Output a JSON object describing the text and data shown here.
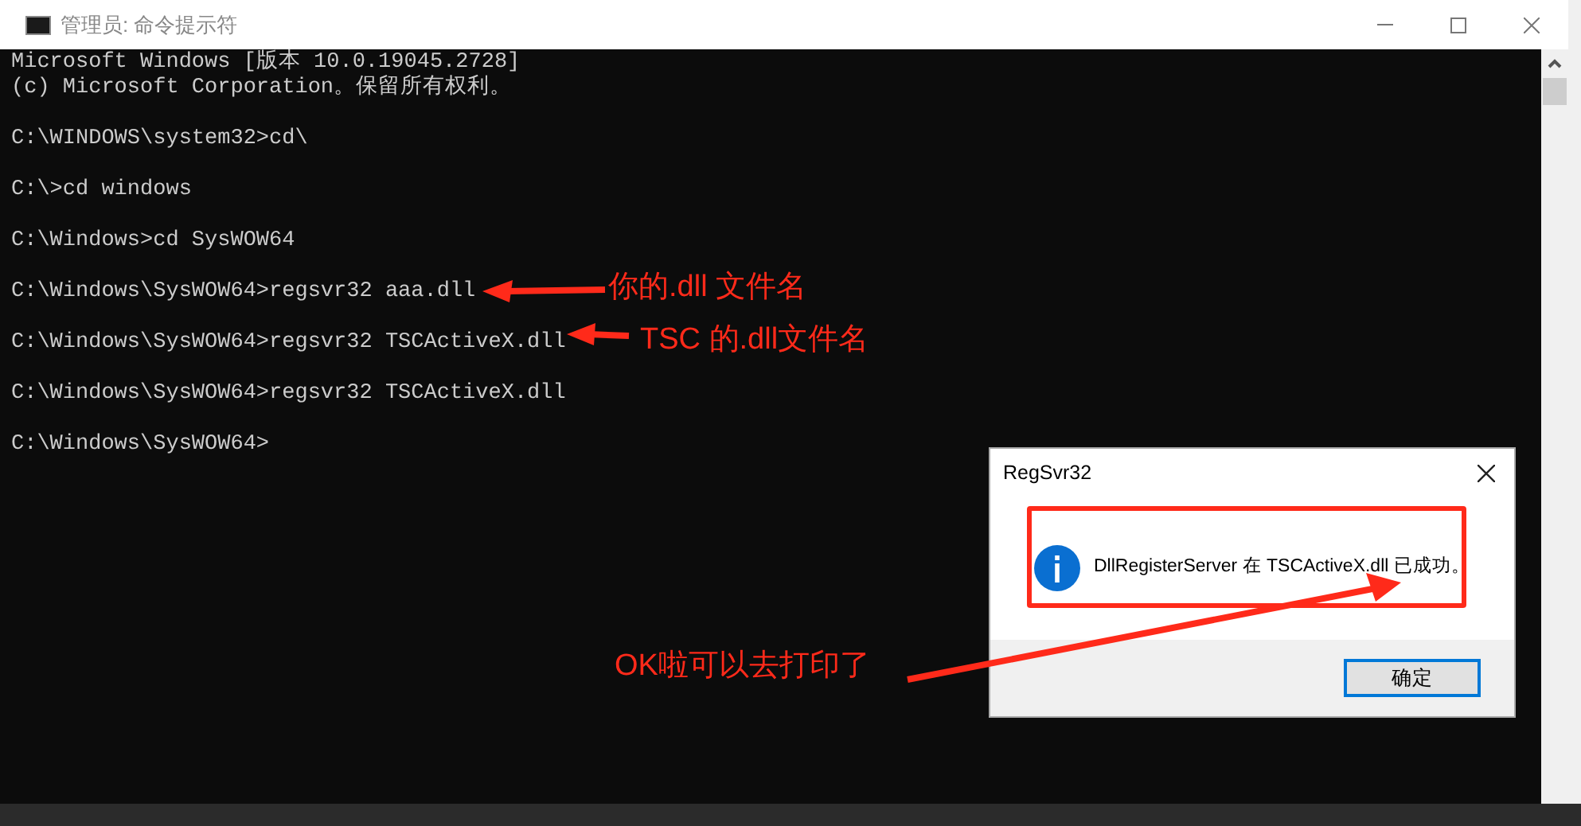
{
  "window": {
    "title": "管理员: 命令提示符"
  },
  "console": {
    "blocks": [
      [
        "Microsoft Windows [版本 10.0.19045.2728]",
        "(c) Microsoft Corporation。保留所有权利。"
      ],
      [
        "C:\\WINDOWS\\system32>cd\\"
      ],
      [
        "C:\\>cd windows"
      ],
      [
        "C:\\Windows>cd SysWOW64"
      ],
      [
        "C:\\Windows\\SysWOW64>regsvr32 aaa.dll"
      ],
      [
        "C:\\Windows\\SysWOW64>regsvr32 TSCActiveX.dll"
      ],
      [
        "C:\\Windows\\SysWOW64>regsvr32 TSCActiveX.dll"
      ],
      [
        "C:\\Windows\\SysWOW64>"
      ]
    ]
  },
  "dialog": {
    "title": "RegSvr32",
    "message": "DllRegisterServer 在 TSCActiveX.dll 已成功。",
    "button": "确定"
  },
  "annotations": [
    {
      "text": "你的.dll 文件名"
    },
    {
      "text": "TSC 的.dll文件名"
    },
    {
      "text": "OK啦可以去打印了"
    }
  ]
}
